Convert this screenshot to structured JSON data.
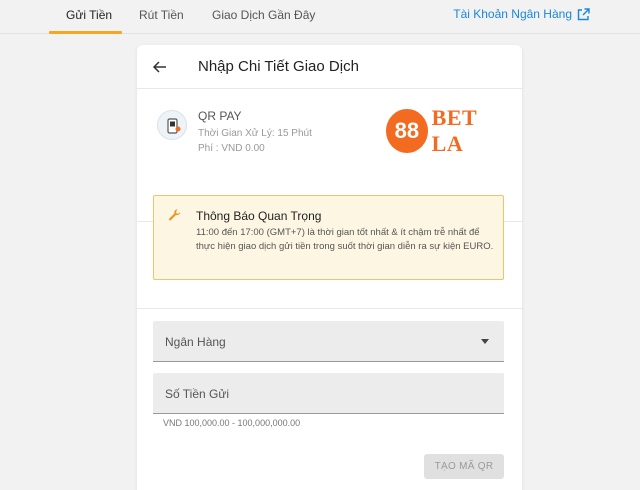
{
  "tabs": [
    {
      "label": "Gửi Tiền",
      "active": true
    },
    {
      "label": "Rút Tiền",
      "active": false
    },
    {
      "label": "Giao Dịch Gần Đây",
      "active": false
    }
  ],
  "bank_account_link": {
    "label": "Tài Khoản Ngân Hàng",
    "icon": "external-link-icon",
    "color": "#1a87d8"
  },
  "card": {
    "title": "Nhập Chi Tiết Giao Dịch",
    "back_icon": "arrow-left-icon",
    "method": {
      "name": "QR PAY",
      "processing_time": "Thời Gian Xử Lý: 15 Phút",
      "fee": "Phí : VND 0.00",
      "icon": "qr-phone-icon"
    },
    "brand": {
      "circle": "88",
      "text": "BET LA",
      "color": "#f26b21"
    },
    "notice": {
      "title": "Thông Báo Quan Trọng",
      "body": "11:00 đến 17:00 (GMT+7) là thời gian tốt nhất & ít chậm trễ nhất để thực hiện giao dịch gửi tiền trong suốt thời gian diễn ra sự kiện EURO.",
      "icon": "wrench-icon",
      "border_color": "#f0c36d"
    },
    "bank_select": {
      "label": "Ngân Hàng",
      "icon": "caret-down-icon"
    },
    "amount_input": {
      "label": "Số Tiền Gửi"
    },
    "amount_range": "VND 100,000.00 - 100,000,000.00",
    "submit_label": "TẠO MÃ QR"
  },
  "colors": {
    "accent_underline": "#f5a623",
    "background": "#f2f2f2"
  }
}
